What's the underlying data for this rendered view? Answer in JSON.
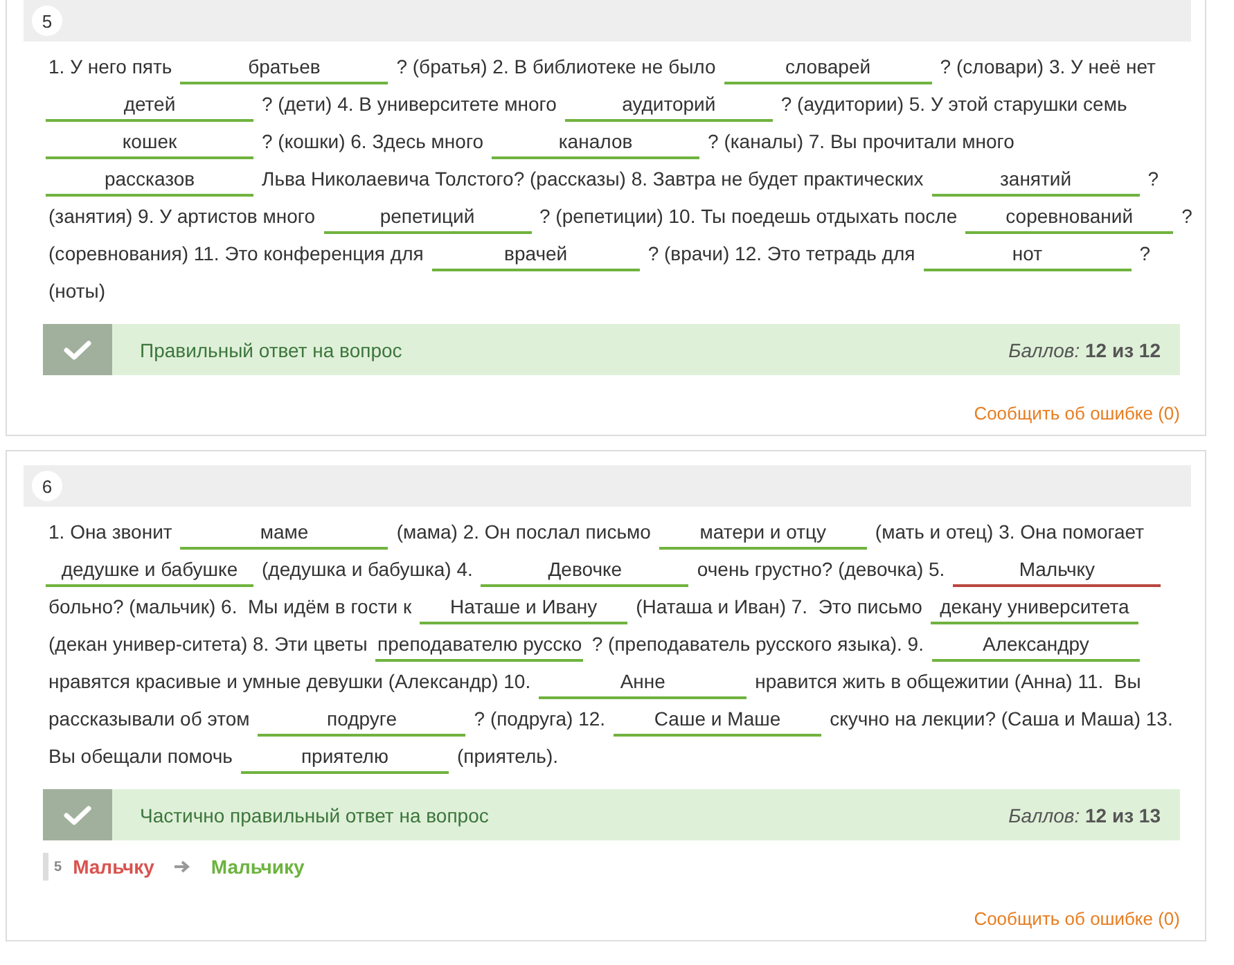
{
  "questions": [
    {
      "number": "5",
      "lines": [
        [
          {
            "kind": "text",
            "text": "1. У него пять"
          },
          {
            "kind": "blank",
            "value": "братьев",
            "correct": true
          },
          {
            "kind": "text",
            "text": "? (братья) 2. В библиотеке не было"
          },
          {
            "kind": "blank",
            "value": "словарей",
            "correct": true
          },
          {
            "kind": "text",
            "text": "? (словари) 3. У неё нет"
          }
        ],
        [
          {
            "kind": "blank",
            "value": "детей",
            "correct": true
          },
          {
            "kind": "text",
            "text": "? (дети) 4. В университете много"
          },
          {
            "kind": "blank",
            "value": "аудиторий",
            "correct": true
          },
          {
            "kind": "text",
            "text": "? (аудитории) 5. У этой старушки семь"
          }
        ],
        [
          {
            "kind": "blank",
            "value": "кошек",
            "correct": true
          },
          {
            "kind": "text",
            "text": "? (кошки) 6. Здесь много"
          },
          {
            "kind": "blank",
            "value": "каналов",
            "correct": true
          },
          {
            "kind": "text",
            "text": "? (каналы) 7. Вы прочитали много"
          }
        ],
        [
          {
            "kind": "blank",
            "value": "рассказов",
            "correct": true
          },
          {
            "kind": "text",
            "text": "Льва Николаевича Толстого? (рассказы) 8. Завтра не будет практических"
          },
          {
            "kind": "blank",
            "value": "занятий",
            "correct": true
          },
          {
            "kind": "text",
            "text": "?"
          }
        ],
        [
          {
            "kind": "text",
            "text": "(занятия) 9. У артистов много"
          },
          {
            "kind": "blank",
            "value": "репетиций",
            "correct": true
          },
          {
            "kind": "text",
            "text": "? (репетиции) 10. Ты поедешь отдыхать после"
          },
          {
            "kind": "blank",
            "value": "соревнований",
            "correct": true
          },
          {
            "kind": "text",
            "text": "?"
          }
        ],
        [
          {
            "kind": "text",
            "text": "(соревнования) 11. Это конференция для"
          },
          {
            "kind": "blank",
            "value": "врачей",
            "correct": true
          },
          {
            "kind": "text",
            "text": "? (врачи) 12. Это тетрадь для"
          },
          {
            "kind": "blank",
            "value": "нот",
            "correct": true
          },
          {
            "kind": "text",
            "text": "?"
          }
        ],
        [
          {
            "kind": "text",
            "text": "(ноты)"
          }
        ]
      ],
      "result": {
        "status": "Правильный ответ на вопрос",
        "score": "*Баллов:* **12 из 12**"
      },
      "report_link": "Сообщить об ошибке (0)"
    },
    {
      "number": "6",
      "lines": [
        [
          {
            "kind": "text",
            "text": "1. Она звонит"
          },
          {
            "kind": "blank",
            "value": "маме",
            "correct": true
          },
          {
            "kind": "text",
            "text": "(мама) 2. Он послал письмо"
          },
          {
            "kind": "blank",
            "value": "матери и отцу",
            "correct": true
          },
          {
            "kind": "text",
            "text": "(мать и отец) 3. Она помогает"
          }
        ],
        [
          {
            "kind": "blank",
            "value": "дедушке и бабушке",
            "correct": true
          },
          {
            "kind": "text",
            "text": "(дедушка и бабушка) 4."
          },
          {
            "kind": "blank",
            "value": "Девочке",
            "correct": true
          },
          {
            "kind": "text",
            "text": "очень грустно? (девочка) 5."
          },
          {
            "kind": "blank",
            "value": "Мальчку",
            "correct": false
          }
        ],
        [
          {
            "kind": "text",
            "text": "больно? (мальчик) 6.  Мы идём в гости к"
          },
          {
            "kind": "blank",
            "value": "Наташе и Ивану",
            "correct": true
          },
          {
            "kind": "text",
            "text": "(Наташа и Иван) 7.  Это письмо"
          },
          {
            "kind": "blank",
            "value": "декану университета",
            "correct": true
          }
        ],
        [
          {
            "kind": "text",
            "text": "(декан универ-ситета) 8. Эти цветы"
          },
          {
            "kind": "blank",
            "value": "преподавателю русско",
            "correct": true
          },
          {
            "kind": "text",
            "text": "? (преподаватель русского языка). 9."
          },
          {
            "kind": "blank",
            "value": "Александру",
            "correct": true
          }
        ],
        [
          {
            "kind": "text",
            "text": "нравятся красивые и умные девушки (Александр) 10."
          },
          {
            "kind": "blank",
            "value": "Анне",
            "correct": true
          },
          {
            "kind": "text",
            "text": "нравится жить в общежитии (Анна) 11.  Вы"
          }
        ],
        [
          {
            "kind": "text",
            "text": "рассказывали об этом"
          },
          {
            "kind": "blank",
            "value": "подруге",
            "correct": true
          },
          {
            "kind": "text",
            "text": "? (подруга) 12."
          },
          {
            "kind": "blank",
            "value": "Саше и Маше",
            "correct": true
          },
          {
            "kind": "text",
            "text": "скучно на лекции? (Саша и Маша) 13."
          }
        ],
        [
          {
            "kind": "text",
            "text": "Вы обещали помочь"
          },
          {
            "kind": "blank",
            "value": "приятелю",
            "correct": true
          },
          {
            "kind": "text",
            "text": "(приятель)."
          }
        ]
      ],
      "result": {
        "status": "Частично правильный ответ на вопрос",
        "score": "*Баллов:* **12 из 13**"
      },
      "corrections": [
        {
          "number": "5",
          "wrong": "Мальчку",
          "right": "Мальчику"
        }
      ],
      "report_link": "Сообщить об ошибке (0)"
    }
  ]
}
